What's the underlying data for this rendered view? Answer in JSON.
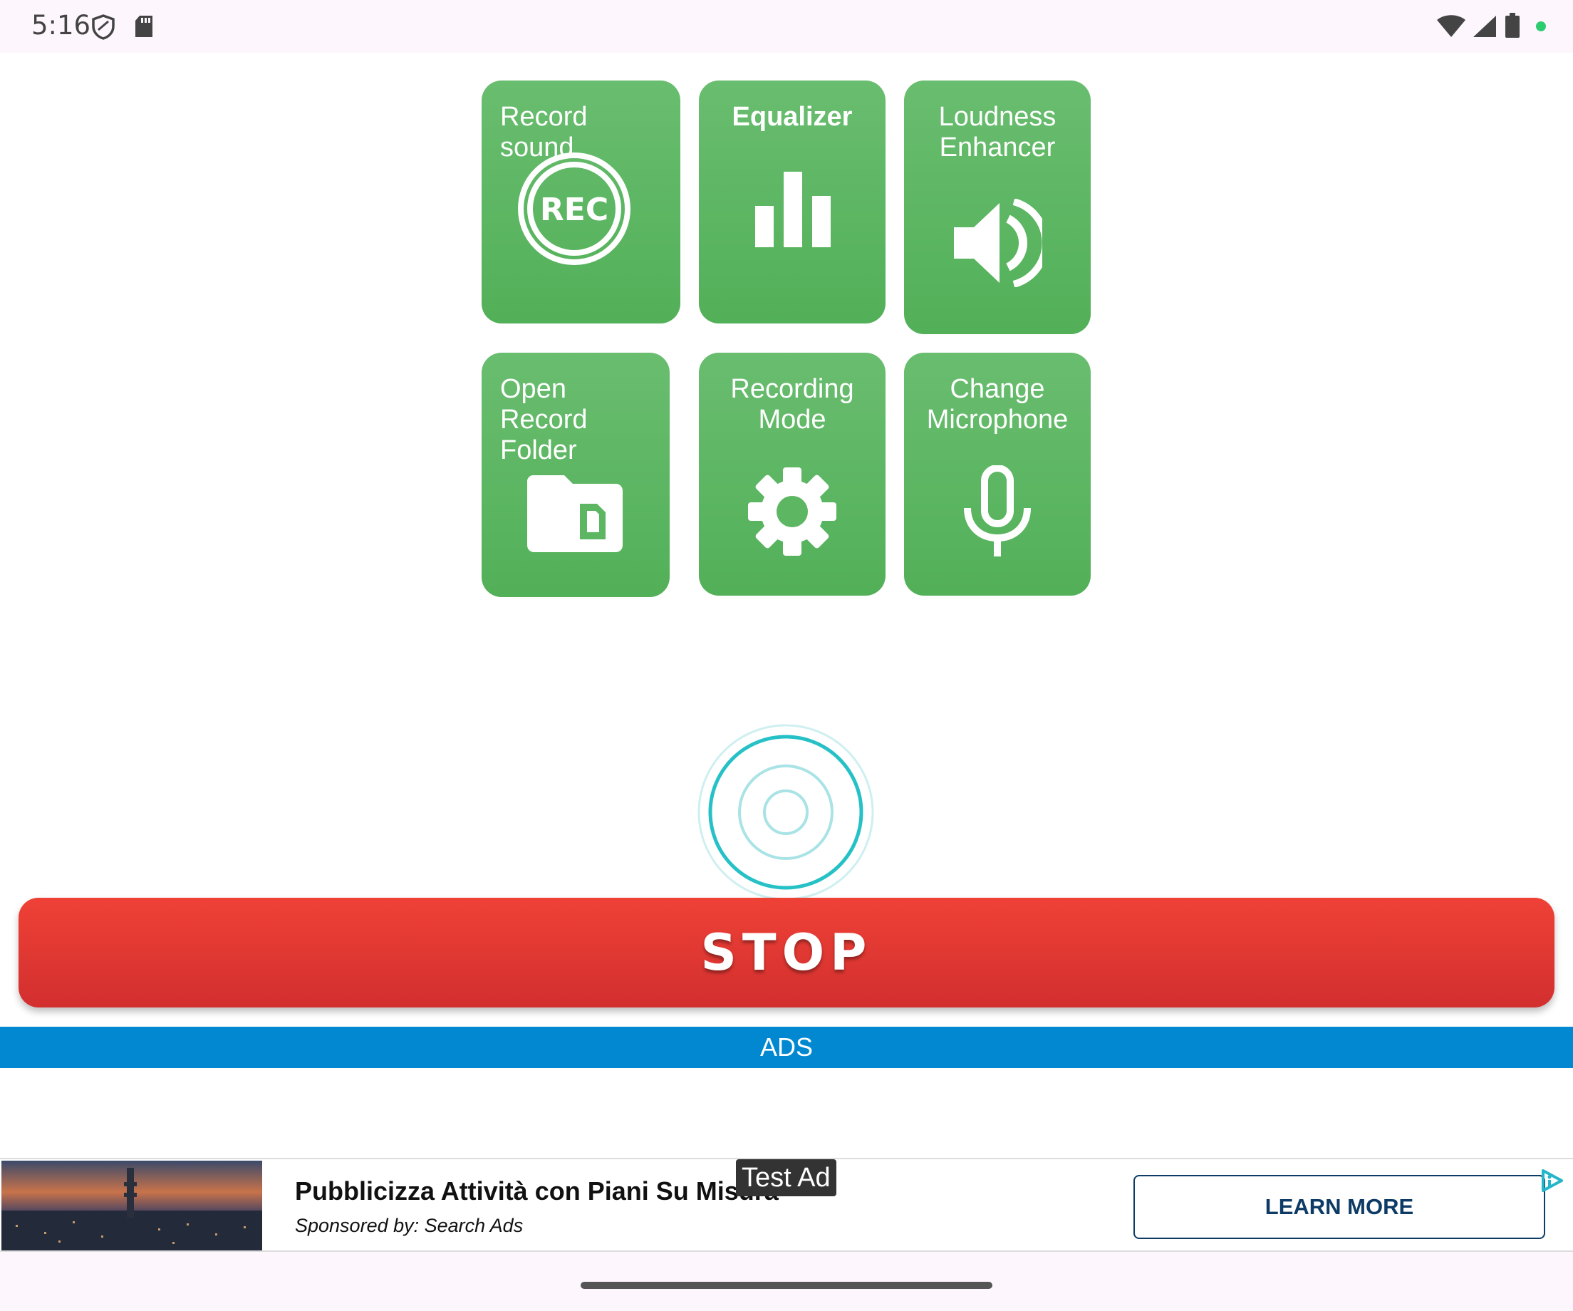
{
  "status_bar": {
    "time": "5:16",
    "icons": [
      "shield-icon",
      "sd-card-icon",
      "wifi-icon",
      "signal-icon",
      "battery-icon",
      "privacy-dot"
    ]
  },
  "tiles": {
    "record": {
      "label": "Record sound",
      "icon": "rec-icon"
    },
    "equalizer": {
      "label": "Equalizer",
      "icon": "equalizer-icon"
    },
    "loudness": {
      "label": "Loudness\nEnhancer",
      "icon": "speaker-icon"
    },
    "folder": {
      "label": "Open Record\nFolder",
      "icon": "folder-icon"
    },
    "mode": {
      "label": "Recording\nMode",
      "icon": "gear-icon"
    },
    "mic": {
      "label": "Change\nMicrophone",
      "icon": "microphone-icon"
    }
  },
  "rec_icon_text": "REC",
  "stop_button": {
    "label": "STOP"
  },
  "ads_bar": {
    "label": "ADS"
  },
  "ad": {
    "badge": "Test Ad",
    "title": "Pubblicizza Attività con Piani Su Misura",
    "sponsor": "Sponsored by: Search Ads",
    "cta": "LEARN MORE"
  },
  "colors": {
    "tile_green": "#5cb662",
    "stop_red": "#e13a33",
    "ads_blue": "#0288d1",
    "indicator_teal": "#26c1c6"
  }
}
